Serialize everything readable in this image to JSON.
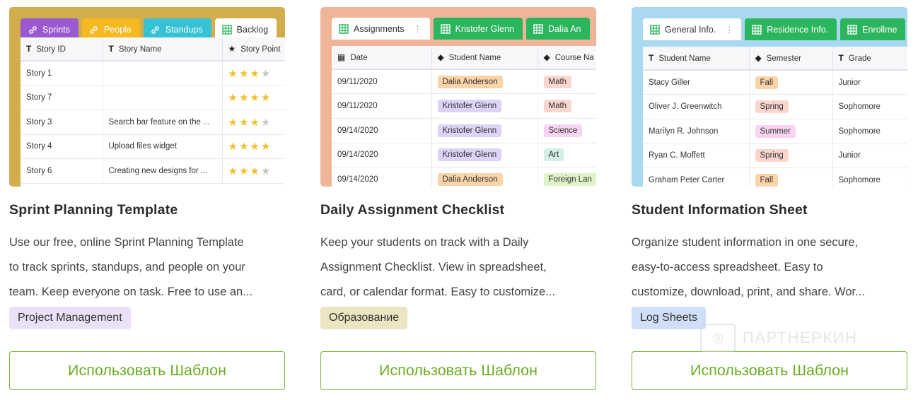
{
  "colors": {
    "accent_green": "#6aad21",
    "sprint_bg": "#d2ad4c",
    "daily_bg": "#f0b599",
    "student_bg": "#a9d8f1"
  },
  "cards": [
    {
      "title": "Sprint Planning Template",
      "desc_lines": [
        "Use our free, online Sprint Planning Template",
        "to track sprints, standups, and people on your",
        "team. Keep everyone on task. Free to use an..."
      ],
      "badge": "Project Management",
      "badge_color": "#ebe1f7",
      "button": "Использовать Шаблон",
      "tabs": [
        {
          "label": "Sprints",
          "icon": "link-icon",
          "color": "#9b59d1"
        },
        {
          "label": "People",
          "icon": "link-icon",
          "color": "#f5b920"
        },
        {
          "label": "Standups",
          "icon": "link-icon",
          "color": "#35c2d5"
        },
        {
          "label": "Backlog",
          "icon": "grid-icon",
          "color": "#ffffff"
        }
      ],
      "columns": [
        {
          "icon": "T",
          "label": "Story ID"
        },
        {
          "icon": "T",
          "label": "Story Name"
        },
        {
          "icon": "★",
          "label": "Story Point"
        }
      ],
      "rows": [
        {
          "id": "Story 1",
          "name": "",
          "stars": 3
        },
        {
          "id": "Story 7",
          "name": "",
          "stars": 4
        },
        {
          "id": "Story 3",
          "name": "Search bar feature on the ...",
          "stars": 3
        },
        {
          "id": "Story 4",
          "name": "Upload files widget",
          "stars": 4
        },
        {
          "id": "Story 6",
          "name": "Creating new designs for ...",
          "stars": 3
        }
      ]
    },
    {
      "title": "Daily Assignment Checklist",
      "desc_lines": [
        "Keep your students on track with a Daily",
        "Assignment Checklist. View in spreadsheet,",
        "card, or calendar format. Easy to customize..."
      ],
      "badge": "Образование",
      "badge_color": "#ece5c1",
      "button": "Использовать Шаблон",
      "tabs": [
        {
          "label": "Assignments",
          "icon": "grid-icon",
          "color": "#ffffff"
        },
        {
          "label": "Kristofer Glenn",
          "icon": "grid-icon",
          "color": "#2bb55c"
        },
        {
          "label": "Dalia An",
          "icon": "grid-icon",
          "color": "#2bb55c"
        }
      ],
      "columns": [
        {
          "icon": "▦",
          "label": "Date"
        },
        {
          "icon": "◆",
          "label": "Student Name"
        },
        {
          "icon": "◆",
          "label": "Course Na"
        }
      ],
      "rows": [
        {
          "date": "09/11/2020",
          "student": "Dalia Anderson",
          "student_color": "#fbd3a8",
          "course": "Math",
          "course_color": "#fbd6cf"
        },
        {
          "date": "09/11/2020",
          "student": "Kristofer Glenn",
          "student_color": "#dcd3f6",
          "course": "Math",
          "course_color": "#fbd6cf"
        },
        {
          "date": "09/14/2020",
          "student": "Kristofer Glenn",
          "student_color": "#dcd3f6",
          "course": "Science",
          "course_color": "#f9d4f2"
        },
        {
          "date": "09/14/2020",
          "student": "Kristofer Glenn",
          "student_color": "#dcd3f6",
          "course": "Art",
          "course_color": "#d3efe4"
        },
        {
          "date": "09/14/2020",
          "student": "Dalia Anderson",
          "student_color": "#fbd3a8",
          "course": "Foreign Lan",
          "course_color": "#e0f2c8"
        }
      ]
    },
    {
      "title": "Student Information Sheet",
      "desc_lines": [
        "Organize student information in one secure,",
        "easy-to-access spreadsheet. Easy to",
        "customize, download, print, and share. Wor..."
      ],
      "badge": "Log Sheets",
      "badge_color": "#cfdff7",
      "button": "Использовать Шаблон",
      "tabs": [
        {
          "label": "General Info.",
          "icon": "grid-icon",
          "color": "#ffffff"
        },
        {
          "label": "Residence Info.",
          "icon": "grid-icon",
          "color": "#2bb55c"
        },
        {
          "label": "Enrollme",
          "icon": "grid-icon",
          "color": "#2bb55c"
        }
      ],
      "columns": [
        {
          "icon": "T",
          "label": "Student Name"
        },
        {
          "icon": "◆",
          "label": "Semester"
        },
        {
          "icon": "T",
          "label": "Grade"
        }
      ],
      "rows": [
        {
          "name": "Stacy Giller",
          "semester": "Fall",
          "semester_color": "#fbd3a8",
          "grade": "Junior"
        },
        {
          "name": "Oliver J. Greenwitch",
          "semester": "Spring",
          "semester_color": "#fbd6cf",
          "grade": "Sophomore"
        },
        {
          "name": "Marilyn R. Johnson",
          "semester": "Summer",
          "semester_color": "#f9d4f2",
          "grade": "Sophomore"
        },
        {
          "name": "Ryan C. Moffett",
          "semester": "Spring",
          "semester_color": "#fbd6cf",
          "grade": "Junior"
        },
        {
          "name": "Graham Peter Carter",
          "semester": "Fall",
          "semester_color": "#fbd3a8",
          "grade": "Sophomore"
        }
      ]
    }
  ],
  "watermark": "ПАРТНЕРКИН"
}
